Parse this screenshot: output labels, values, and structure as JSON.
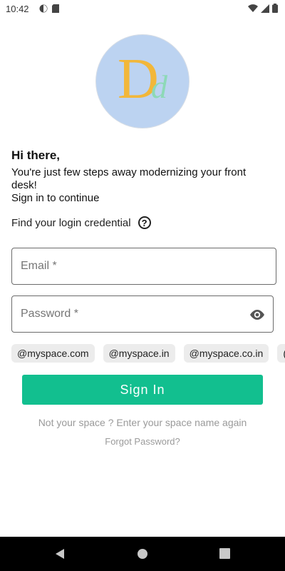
{
  "status_bar": {
    "time": "10:42"
  },
  "logo": {
    "main_letter": "D",
    "sub_letter": "d"
  },
  "greeting": "Hi there,",
  "intro": "You're just few steps away modernizing your front desk!",
  "signin_prompt": "Sign in to continue",
  "credentials": {
    "label": "Find your login credential",
    "help": "?"
  },
  "email": {
    "placeholder": "Email *",
    "value": ""
  },
  "password": {
    "placeholder": "Password *",
    "value": ""
  },
  "domains": [
    "@myspace.com",
    "@myspace.in",
    "@myspace.co.in",
    "("
  ],
  "signin_button": "Sign In",
  "not_your_space": "Not your space ? Enter your space name again",
  "forgot_password": "Forgot Password?",
  "colors": {
    "accent": "#12bf8f",
    "logo_bg": "#bcd3f1",
    "logo_gold": "#f2b73a",
    "logo_mint": "#8dd9b7"
  }
}
